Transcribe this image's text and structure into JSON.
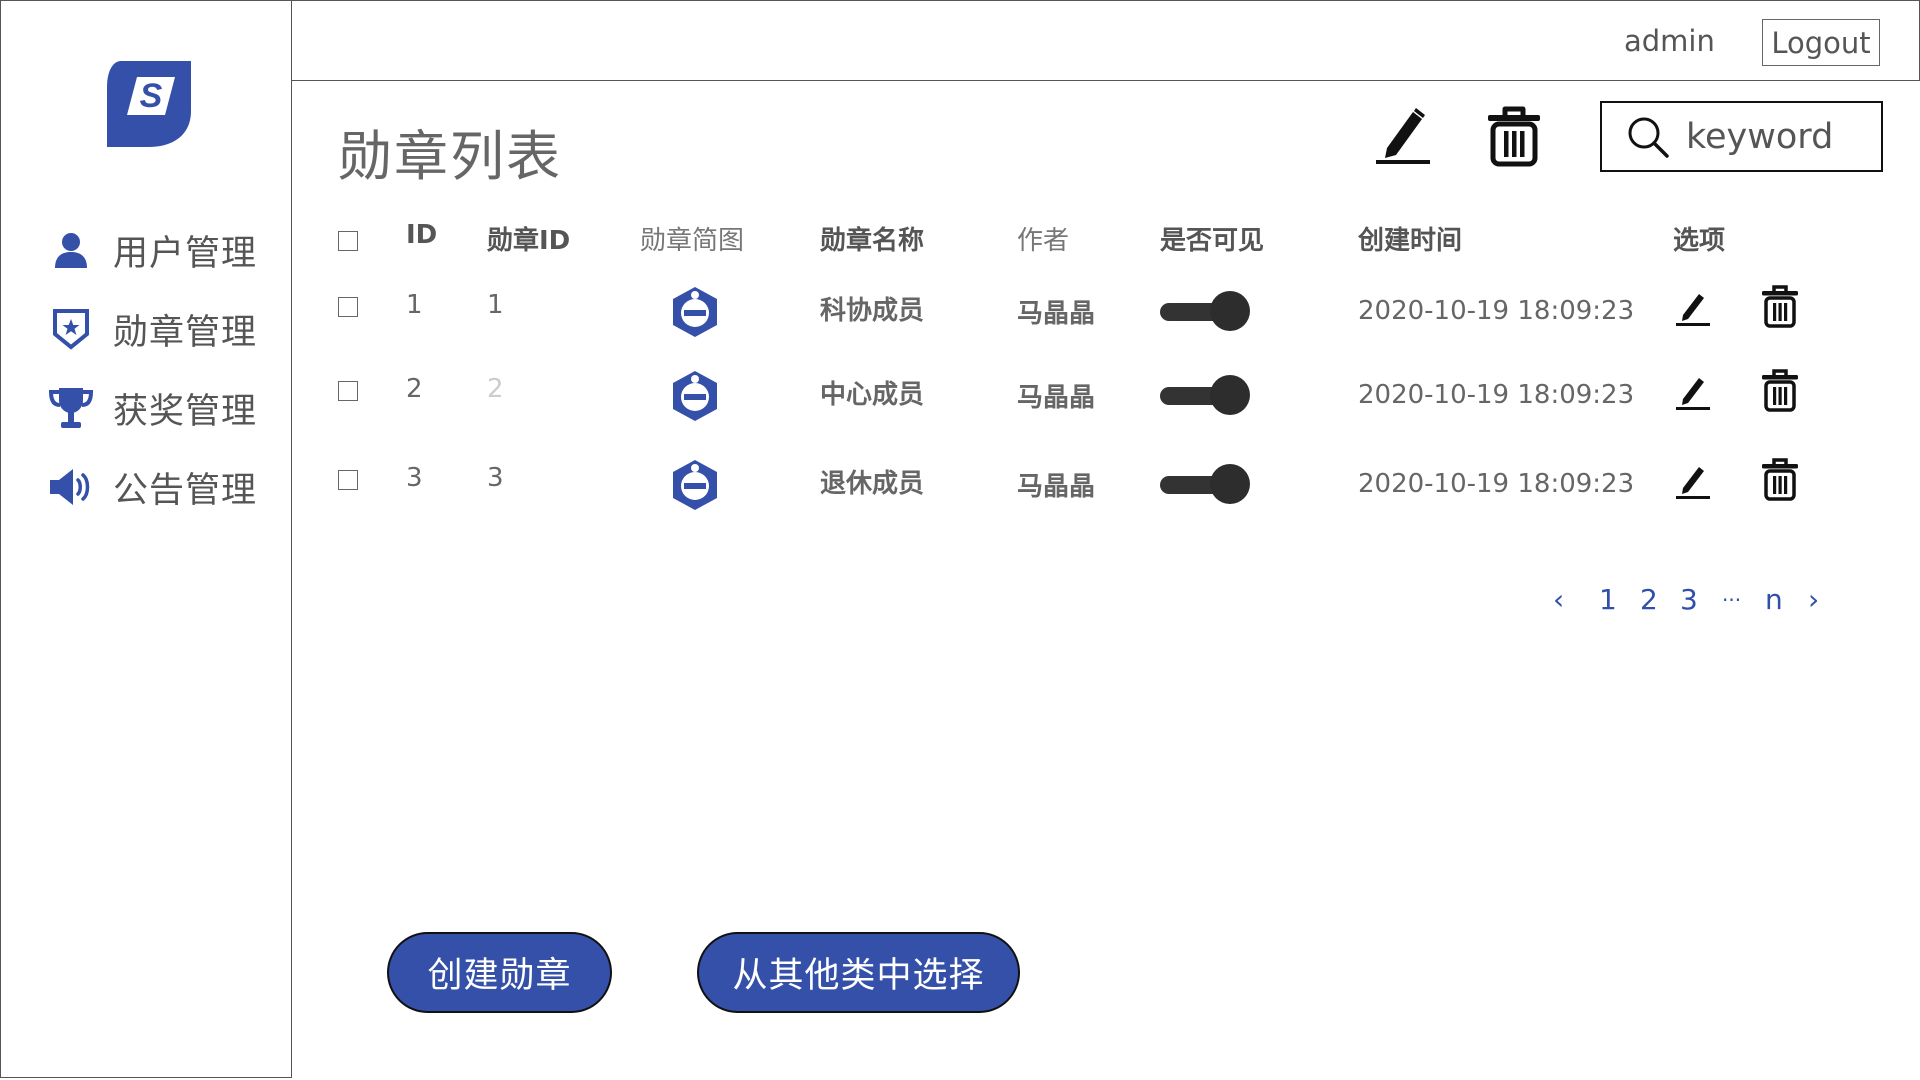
{
  "colors": {
    "accent": "#3450a8",
    "toggle_on": "#2d2d2d",
    "link": "#2f4faa"
  },
  "sidebar": {
    "items": [
      {
        "label": "用户管理",
        "icon": "user-icon"
      },
      {
        "label": "勋章管理",
        "icon": "shield-star-icon"
      },
      {
        "label": "获奖管理",
        "icon": "trophy-icon"
      },
      {
        "label": "公告管理",
        "icon": "megaphone-icon"
      }
    ]
  },
  "header": {
    "user": "admin",
    "logout_label": "Logout"
  },
  "main": {
    "title": "勋章列表",
    "search": {
      "placeholder": "keyword",
      "value": ""
    },
    "table": {
      "columns": [
        "ID",
        "勋章ID",
        "勋章简图",
        "勋章名称",
        "作者",
        "是否可见",
        "创建时间",
        "选项"
      ],
      "rows": [
        {
          "id": "1",
          "medal_id": "1",
          "name": "科协成员",
          "author": "马晶晶",
          "visible": true,
          "created": "2020-10-19 18:09:23"
        },
        {
          "id": "2",
          "medal_id": "2",
          "name": "中心成员",
          "author": "马晶晶",
          "visible": true,
          "created": "2020-10-19 18:09:23"
        },
        {
          "id": "3",
          "medal_id": "3",
          "name": "退休成员",
          "author": "马晶晶",
          "visible": true,
          "created": "2020-10-19 18:09:23"
        }
      ]
    },
    "pagination": {
      "prev": "‹",
      "pages": [
        "1",
        "2",
        "3",
        "···",
        "n"
      ],
      "next": "›"
    },
    "buttons": {
      "create": "创建勋章",
      "select_other": "从其他类中选择"
    }
  }
}
